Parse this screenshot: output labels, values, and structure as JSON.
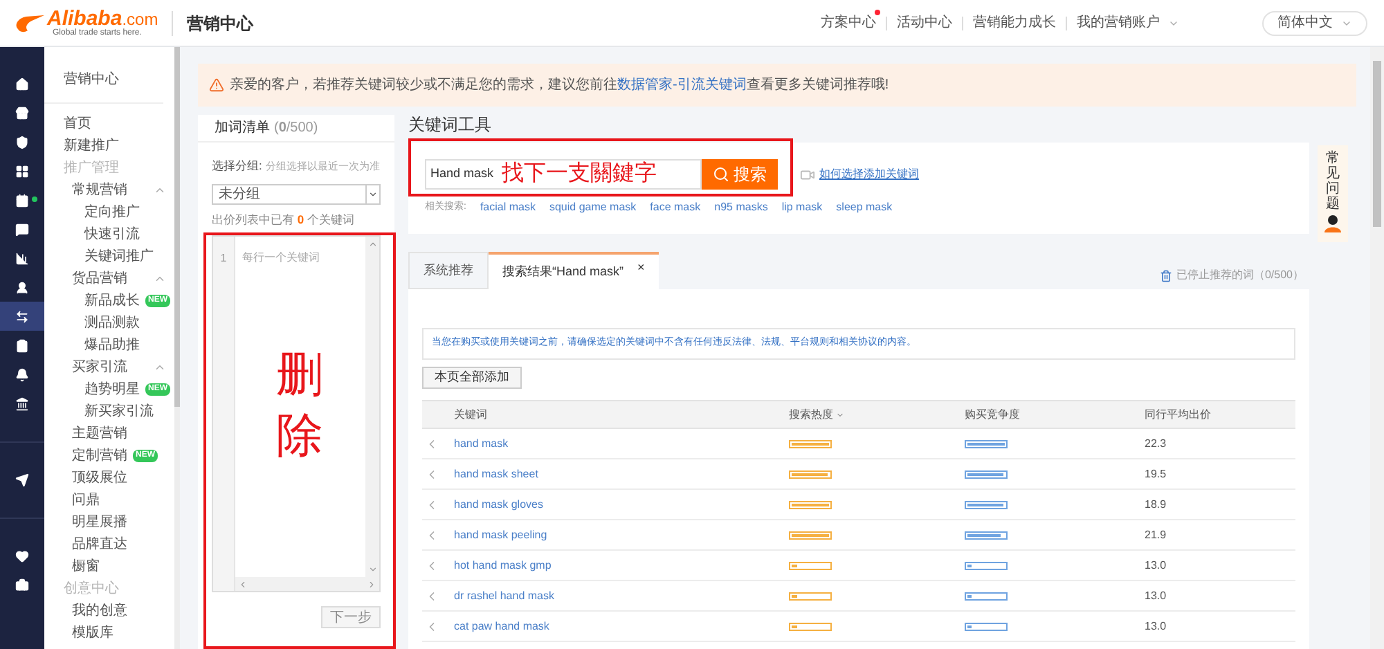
{
  "header": {
    "logo": {
      "brand": "Alibaba",
      "domain": ".com",
      "tagline": "Global trade starts here."
    },
    "title": "营销中心",
    "nav": [
      {
        "label": "方案中心",
        "badge": true
      },
      {
        "label": "活动中心"
      },
      {
        "label": "营销能力成长"
      },
      {
        "label": "我的营销账户",
        "caret": true
      }
    ],
    "language": "简体中文"
  },
  "rail": [
    {
      "items": [
        {
          "kind": "home",
          "selected": false
        },
        {
          "kind": "store",
          "selected": false
        },
        {
          "kind": "shield",
          "selected": false
        },
        {
          "kind": "grid",
          "selected": false
        },
        {
          "kind": "calendar",
          "selected": false,
          "dot": true
        },
        {
          "kind": "chat",
          "selected": false
        },
        {
          "kind": "chart",
          "selected": false
        },
        {
          "kind": "user",
          "selected": false
        },
        {
          "kind": "arrows",
          "selected": true
        },
        {
          "kind": "clipboard",
          "selected": false
        },
        {
          "kind": "bell",
          "selected": false
        },
        {
          "kind": "bank",
          "selected": false
        }
      ]
    },
    {
      "items": [
        {
          "kind": "send",
          "selected": false
        }
      ]
    },
    {
      "items": [
        {
          "kind": "heart",
          "selected": false
        },
        {
          "kind": "briefcase",
          "selected": false
        }
      ]
    }
  ],
  "sidebar": {
    "title": "营销中心",
    "items": [
      {
        "kind": "item",
        "label": "首页"
      },
      {
        "kind": "item",
        "label": "新建推广"
      },
      {
        "kind": "section",
        "label": "推广管理",
        "children": [
          {
            "kind": "group",
            "label": "常规营销",
            "expanded": true,
            "children": [
              {
                "kind": "item",
                "label": "定向推广"
              },
              {
                "kind": "item",
                "label": "快速引流"
              },
              {
                "kind": "item",
                "label": "关键词推广"
              }
            ]
          },
          {
            "kind": "group",
            "label": "货品营销",
            "expanded": true,
            "children": [
              {
                "kind": "item",
                "label": "新品成长",
                "badge": "NEW"
              },
              {
                "kind": "item",
                "label": "测品测款"
              },
              {
                "kind": "item",
                "label": "爆品助推"
              }
            ]
          },
          {
            "kind": "group",
            "label": "买家引流",
            "expanded": true,
            "children": [
              {
                "kind": "item",
                "label": "趋势明星",
                "badge": "NEW"
              },
              {
                "kind": "item",
                "label": "新买家引流"
              }
            ]
          },
          {
            "kind": "item",
            "label": "主题营销"
          },
          {
            "kind": "item",
            "label": "定制营销",
            "badge": "NEW"
          },
          {
            "kind": "item",
            "label": "顶级展位"
          },
          {
            "kind": "item",
            "label": "问鼎"
          },
          {
            "kind": "item",
            "label": "明星展播"
          },
          {
            "kind": "item",
            "label": "品牌直达"
          },
          {
            "kind": "item",
            "label": "橱窗"
          }
        ]
      },
      {
        "kind": "section",
        "label": "创意中心",
        "children": [
          {
            "kind": "item",
            "label": "我的创意"
          },
          {
            "kind": "item",
            "label": "模版库"
          }
        ]
      }
    ]
  },
  "notice": {
    "before": "亲爱的客户，若推荐关键词较少或不满足您的需求，建议您前往",
    "link": "数据管家-引流关键词",
    "after": "查看更多关键词推荐哦!"
  },
  "word_list": {
    "title": "加词清单",
    "count": "(**0**/500)",
    "group_label": "选择分组:",
    "group_hint": "分组选择以最近一次为准",
    "group_value": "未分组",
    "status_before": "出价列表中已有",
    "status_count": "0",
    "status_after": "个关键词",
    "line_number": "1",
    "placeholder": "每行一个关键词",
    "next": "下一步",
    "next_disabled": true
  },
  "tool": {
    "title": "关键词工具",
    "query": "Hand mask",
    "search": "搜索",
    "help_link": "如何选择添加关键词",
    "related_label": "相关搜索:",
    "related": [
      "facial mask",
      "squid game mask",
      "face mask",
      "n95 masks",
      "lip mask",
      "sleep mask"
    ]
  },
  "tabs": [
    {
      "label": "系统推荐",
      "selected": false
    },
    {
      "label": "搜索结果“Hand mask”",
      "selected": true,
      "closable": true
    }
  ],
  "tab_close": "×",
  "stopped": "已停止推荐的词（0/500）",
  "warning": "当您在购买或使用关键词之前，请确保选定的关键词中不含有任何违反法律、法规、平台规则和相关协议的内容。",
  "add_all": "本页全部添加",
  "table": {
    "columns": [
      "关键词",
      "搜索热度",
      "购买竞争度",
      "同行平均出价"
    ],
    "rows": [
      {
        "keyword": "hand mask",
        "heat": {
          "level": 1
        },
        "competition": {
          "level": 1
        },
        "price": "22.3"
      },
      {
        "keyword": "hand mask sheet",
        "heat": {
          "level": 0.95
        },
        "competition": {
          "level": 0.95
        },
        "price": "19.5"
      },
      {
        "keyword": "hand mask gloves",
        "heat": {
          "level": 1
        },
        "competition": {
          "level": 0.95
        },
        "price": "18.9"
      },
      {
        "keyword": "hand mask peeling",
        "heat": {
          "level": 1
        },
        "competition": {
          "level": 0.9
        },
        "price": "21.9"
      },
      {
        "keyword": "hot hand mask gmp",
        "heat": {
          "level": 0.15
        },
        "competition": {
          "level": 0.1
        },
        "price": "13.0"
      },
      {
        "keyword": "dr rashel hand mask",
        "heat": {
          "level": 0.15
        },
        "competition": {
          "level": 0.1
        },
        "price": "13.0"
      },
      {
        "keyword": "cat paw hand mask",
        "heat": {
          "level": 0.15
        },
        "competition": {
          "level": 0.1
        },
        "price": "13.0"
      }
    ]
  },
  "help_widget": "常见问题",
  "annotations": {
    "search": "找下一支關鍵字",
    "list": "删除"
  }
}
